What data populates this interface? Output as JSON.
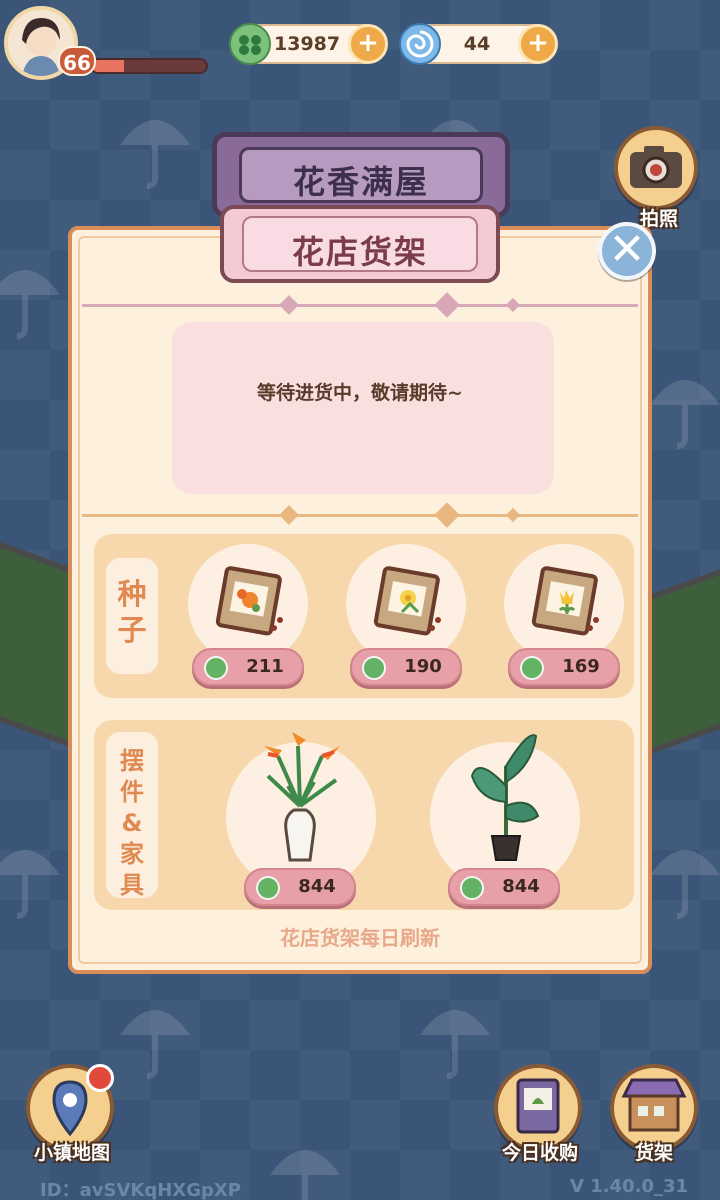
{
  "hud": {
    "level": "66",
    "xp_fraction": 0.28,
    "currency_leaf": "13987",
    "currency_swirl": "44",
    "plus_glyph": "+",
    "leaf_icon": "clover-coin-icon",
    "swirl_icon": "blue-swirl-icon"
  },
  "buttons": {
    "photo_label": "拍照",
    "map_label": "小镇地图",
    "purchase_label": "今日收购",
    "shelf_label": "货架",
    "close_glyph": "✕"
  },
  "panel": {
    "title": "花香满屋",
    "subtitle": "花店货架",
    "message": "等待进货中，敬请期待~",
    "seeds_label": "种子",
    "furniture_label": "摆件&家具",
    "footer": "花店货架每日刷新"
  },
  "seeds": [
    {
      "icon": "seed-packet-orange-flower-icon",
      "price": "211"
    },
    {
      "icon": "seed-packet-daffodil-icon",
      "price": "190"
    },
    {
      "icon": "seed-packet-tulip-icon",
      "price": "169"
    }
  ],
  "furniture": [
    {
      "icon": "bird-of-paradise-vase-icon",
      "price": "844"
    },
    {
      "icon": "banana-leaf-plant-icon",
      "price": "844"
    }
  ],
  "footer_info": {
    "id": "ID：avSVKqHXGpXP",
    "version": "V 1.40.0_31"
  },
  "colors": {
    "background": "#3a5578",
    "panel": "#fdf0dc",
    "accent": "#d98e5a",
    "price_pill": "#e8a0a8"
  }
}
